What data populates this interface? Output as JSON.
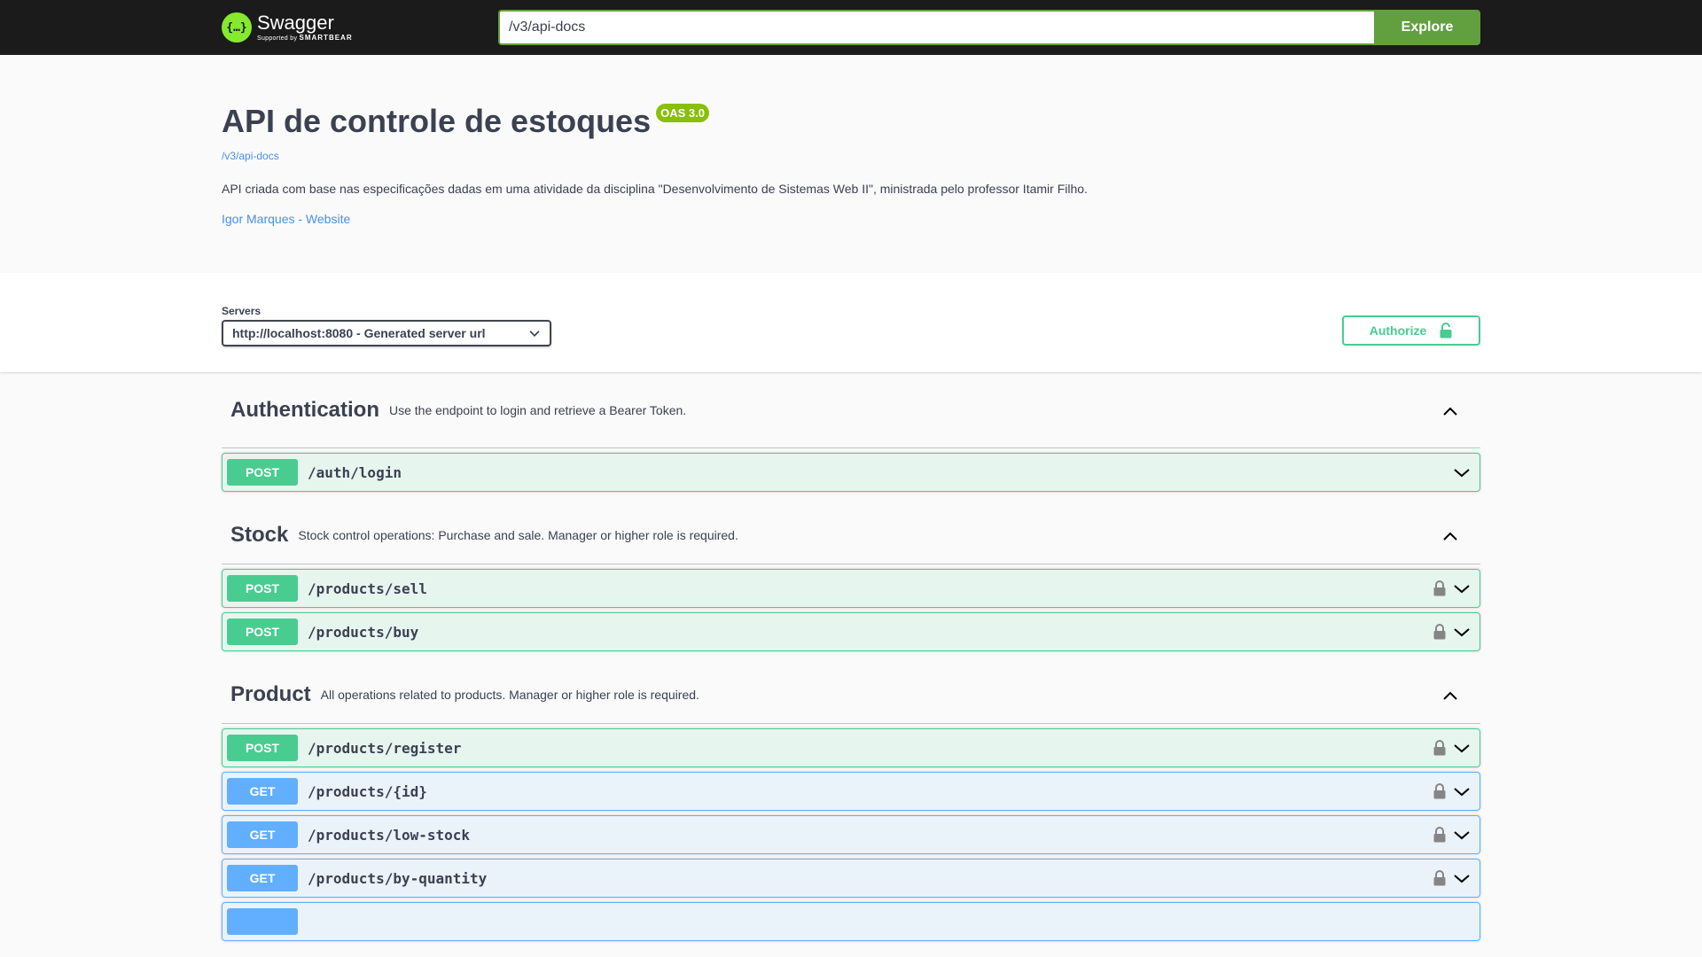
{
  "topbar": {
    "logo_name": "Swagger",
    "logo_sub_prefix": "Supported by",
    "logo_sub_brand": "SMARTBEAR",
    "url_value": "/v3/api-docs",
    "explore_label": "Explore",
    "colors": {
      "bg": "#1b1b1b",
      "accent": "#62a03f",
      "logo": "#85ea2d"
    }
  },
  "info": {
    "title": "API de controle de estoques",
    "version_badge": "OAS 3.0",
    "spec_link": "/v3/api-docs",
    "description": "API criada com base nas especificações dadas em uma atividade da disciplina \"Desenvolvimento de Sistemas Web II\", ministrada pelo professor Itamir Filho.",
    "contact_link": "Igor Marques - Website"
  },
  "servers": {
    "label": "Servers",
    "selected": "http://localhost:8080 - Generated server url",
    "authorize_label": "Authorize"
  },
  "tags": [
    {
      "name": "Authentication",
      "description": "Use the endpoint to login and retrieve a Bearer Token.",
      "operations": [
        {
          "method": "POST",
          "path": "/auth/login",
          "locked": false
        }
      ]
    },
    {
      "name": "Stock",
      "description": "Stock control operations: Purchase and sale. Manager or higher role is required.",
      "operations": [
        {
          "method": "POST",
          "path": "/products/sell",
          "locked": true
        },
        {
          "method": "POST",
          "path": "/products/buy",
          "locked": true
        }
      ]
    },
    {
      "name": "Product",
      "description": "All operations related to products. Manager or higher role is required.",
      "operations": [
        {
          "method": "POST",
          "path": "/products/register",
          "locked": true
        },
        {
          "method": "GET",
          "path": "/products/{id}",
          "locked": true
        },
        {
          "method": "GET",
          "path": "/products/low-stock",
          "locked": true
        },
        {
          "method": "GET",
          "path": "/products/by-quantity",
          "locked": true
        }
      ]
    }
  ]
}
